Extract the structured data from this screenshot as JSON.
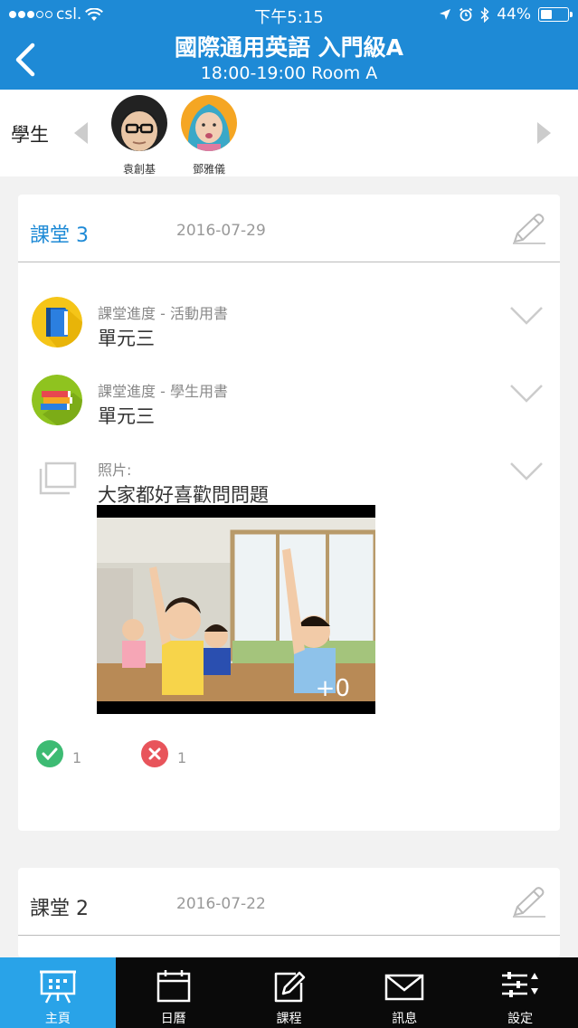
{
  "status_bar": {
    "carrier": "csl.",
    "time": "下午5:15",
    "battery": "44%",
    "battery_level": 0.44
  },
  "header": {
    "title": "國際通用英語 入門級A",
    "subtitle": "18:00-19:00 Room A"
  },
  "students": {
    "label": "學生",
    "items": [
      {
        "name": "袁創基"
      },
      {
        "name": "鄧雅儀"
      }
    ]
  },
  "lessons": [
    {
      "title": "課堂 3",
      "date": "2016-07-29",
      "title_color": "#1e8ad6",
      "items": [
        {
          "label": "課堂進度 - 活動用書",
          "value": "單元三",
          "icon": "blue-book-icon"
        },
        {
          "label": "課堂進度 - 學生用書",
          "value": "單元三",
          "icon": "stacked-books-icon"
        },
        {
          "label": "照片:",
          "value": "大家都好喜歡問問題",
          "icon": "photos-icon"
        }
      ],
      "photo_count": "+0",
      "likes": "1",
      "dislikes": "1"
    },
    {
      "title": "課堂 2",
      "date": "2016-07-22"
    }
  ],
  "tabs": [
    {
      "label": "主頁",
      "icon": "presentation-board-icon",
      "active": true
    },
    {
      "label": "日曆",
      "icon": "calendar-icon"
    },
    {
      "label": "課程",
      "icon": "pencil-document-icon"
    },
    {
      "label": "訊息",
      "icon": "envelope-icon"
    },
    {
      "label": "設定",
      "icon": "sliders-icon"
    }
  ],
  "colors": {
    "header": "#1e8ad6",
    "tab_active": "#29a3e8",
    "tabbar": "#0a0a0a",
    "like": "#3dbb73",
    "dislike": "#e8545b"
  }
}
